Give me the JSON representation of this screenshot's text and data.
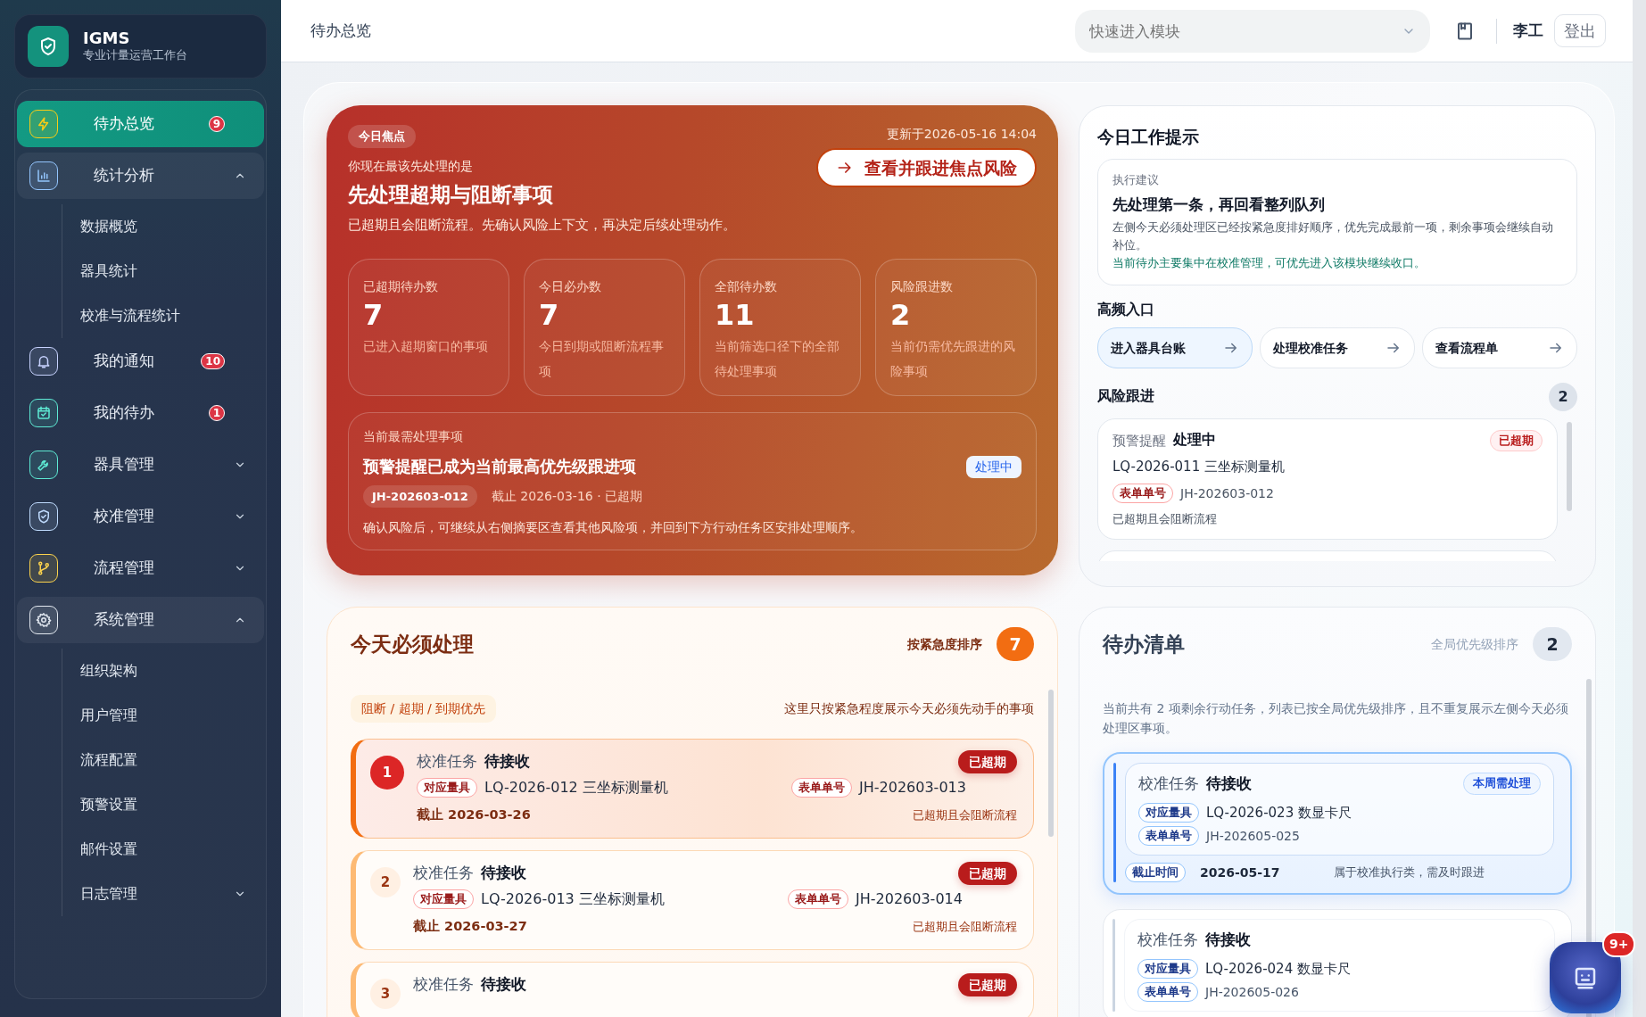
{
  "sidebar": {
    "logo": {
      "title": "IGMS",
      "subtitle": "专业计量运营工作台"
    },
    "items": [
      {
        "label": "待办总览",
        "selected": true,
        "badge": "9"
      },
      {
        "label": "统计分析",
        "selected": false,
        "expanded": true,
        "children": [
          {
            "label": "数据概览",
            "selected": false
          },
          {
            "label": "器具统计",
            "selected": false
          },
          {
            "label": "校准与流程统计",
            "selected": false
          }
        ]
      },
      {
        "label": "我的通知",
        "selected": false,
        "badge": "10"
      },
      {
        "label": "我的待办",
        "selected": false,
        "badge": "1"
      },
      {
        "label": "器具管理",
        "selected": false,
        "expanded": false
      },
      {
        "label": "校准管理",
        "selected": false,
        "expanded": false
      },
      {
        "label": "流程管理",
        "selected": false,
        "expanded": false
      },
      {
        "label": "系统管理",
        "selected": false,
        "expanded": true,
        "children": [
          {
            "label": "组织架构",
            "selected": false
          },
          {
            "label": "用户管理",
            "selected": false
          },
          {
            "label": "流程配置",
            "selected": false
          },
          {
            "label": "预警设置",
            "selected": false
          },
          {
            "label": "邮件设置",
            "selected": false
          },
          {
            "label": "日志管理",
            "selected": false,
            "expanded": false
          }
        ]
      }
    ]
  },
  "topbar": {
    "title": "待办总览",
    "module_select": {
      "placeholder": "快速进入模块"
    },
    "user": "李工",
    "logout": "登出"
  },
  "hero": {
    "tag": "今日焦点",
    "updated": "更新于2026-05-16 14:04",
    "eyebrow": "你现在最该先处理的是",
    "title": "先处理超期与阻断事项",
    "description": "已超期且会阻断流程。先确认风险上下文，再决定后续处理动作。",
    "action": "查看并跟进焦点风险",
    "stats": [
      {
        "label": "已超期待办数",
        "value": "7",
        "note": "已进入超期窗口的事项"
      },
      {
        "label": "今日必办数",
        "value": "7",
        "note": "今日到期或阻断流程事项"
      },
      {
        "label": "全部待办数",
        "value": "11",
        "note": "当前筛选口径下的全部待处理事项"
      },
      {
        "label": "风险跟进数",
        "value": "2",
        "note": "当前仍需优先跟进的风险事项"
      }
    ],
    "focus": {
      "label": "当前最需处理事项",
      "title": "预警提醒已成为当前最高优先级跟进项",
      "code": "JH-202603-012",
      "deadline": "截止 2026-03-16 · 已超期",
      "status": "处理中",
      "note": "确认风险后，可继续从右侧摘要区查看其他风险项，并回到下方行动任务区安排处理顺序。"
    }
  },
  "tips": {
    "title": "今日工作提示",
    "advice": {
      "label": "执行建议",
      "title": "先处理第一条，再回看整列队列",
      "text": "左侧今天必须处理区已经按紧急度排好顺序，优先完成最前一项，剩余事项会继续自动补位。",
      "hint": "当前待办主要集中在校准管理，可优先进入该模块继续收口。"
    },
    "shortcuts_title": "高频入口",
    "shortcuts": [
      {
        "label": "进入器具台账",
        "selected": true
      },
      {
        "label": "处理校准任务",
        "selected": false
      },
      {
        "label": "查看流程单",
        "selected": false
      }
    ],
    "risk": {
      "title": "风险跟进",
      "count": "2",
      "items": [
        {
          "type": "预警提醒",
          "status": "处理中",
          "badge": "已超期",
          "name": "LQ-2026-011 三坐标测量机",
          "tag": "表单单号",
          "code": "JH-202603-012",
          "note": "已超期且会阻断流程"
        }
      ]
    }
  },
  "today": {
    "title": "今天必须处理",
    "sort_label": "按紧急度排序",
    "count": "7",
    "filter": "阻断 / 超期 / 到期优先",
    "hint": "这里只按紧急程度展示今天必须先动手的事项",
    "items": [
      {
        "rank": "1",
        "type": "校准任务",
        "status": "待接收",
        "badge": "已超期",
        "instrument_tag": "对应量具",
        "instrument": "LQ-2026-012 三坐标测量机",
        "form_tag": "表单单号",
        "form": "JH-202603-013",
        "deadline": "截止 2026-03-26",
        "note": "已超期且会阻断流程",
        "selected": true
      },
      {
        "rank": "2",
        "type": "校准任务",
        "status": "待接收",
        "badge": "已超期",
        "instrument_tag": "对应量具",
        "instrument": "LQ-2026-013 三坐标测量机",
        "form_tag": "表单单号",
        "form": "JH-202603-014",
        "deadline": "截止 2026-03-27",
        "note": "已超期且会阻断流程",
        "selected": false
      },
      {
        "rank": "3",
        "type": "校准任务",
        "status": "待接收",
        "badge": "已超期",
        "selected": false
      }
    ]
  },
  "todo": {
    "title": "待办清单",
    "sort_label": "全局优先级排序",
    "count": "2",
    "description": "当前共有 2 项剩余行动任务，列表已按全局优先级排序，且不重复展示左侧今天必须处理区事项。",
    "items": [
      {
        "type": "校准任务",
        "status": "待接收",
        "badge": "本周需处理",
        "instrument_tag": "对应量具",
        "instrument": "LQ-2026-023 数显卡尺",
        "form_tag": "表单单号",
        "form": "JH-202605-025",
        "deadline_tag": "截止时间",
        "deadline": "2026-05-17",
        "note": "属于校准执行类，需及时跟进",
        "selected": true
      },
      {
        "type": "校准任务",
        "status": "待接收",
        "instrument_tag": "对应量具",
        "instrument": "LQ-2026-024 数显卡尺",
        "form_tag": "表单单号",
        "form": "JH-202605-026",
        "selected": false
      }
    ]
  },
  "assistant": {
    "badge": "9+"
  }
}
